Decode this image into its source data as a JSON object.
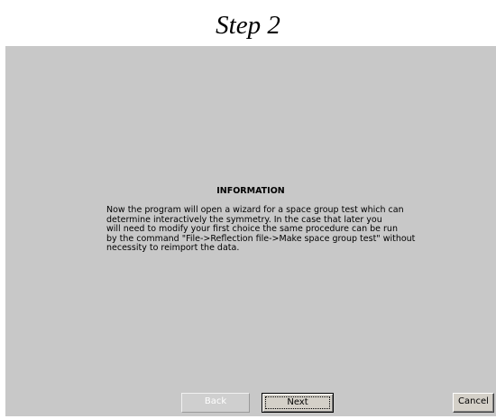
{
  "step_title": "Step 2",
  "dialog": {
    "heading": "INFORMATION",
    "body_lines": [
      "Now the program will open a wizard for a space group test which can",
      "determine interactively the symmetry. In the case that later you",
      "will need to modify your first choice the same procedure can be run",
      "by the command \"File->Reflection file->Make space group test\" without",
      "necessity to reimport the data."
    ],
    "background_color": "#c8c8c8"
  },
  "buttons": {
    "back_label": "Back",
    "next_label": "Next",
    "cancel_label": "Cancel"
  }
}
